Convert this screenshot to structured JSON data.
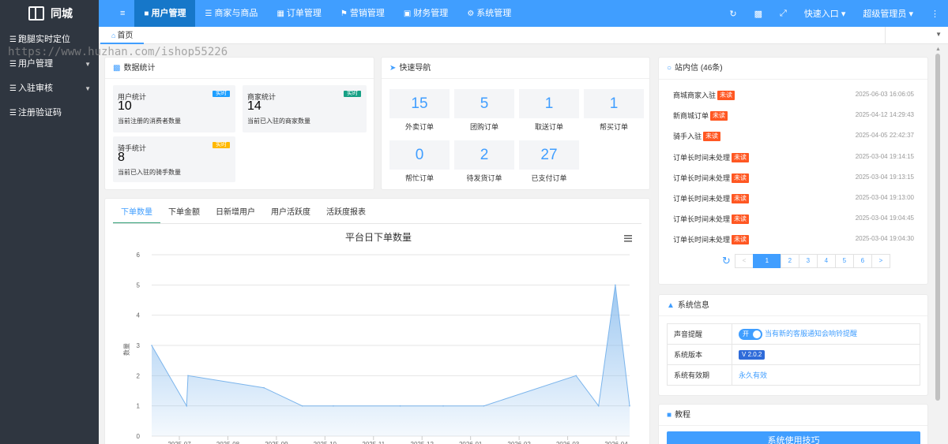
{
  "header": {
    "logo_text": "同城",
    "toggle_icon": "≡",
    "menu": [
      {
        "label": "用户管理",
        "icon": "users-icon"
      },
      {
        "label": "商家与商品",
        "icon": "list-icon"
      },
      {
        "label": "订单管理",
        "icon": "grid-icon"
      },
      {
        "label": "营销管理",
        "icon": "flag-icon"
      },
      {
        "label": "财务管理",
        "icon": "wallet-icon"
      },
      {
        "label": "系统管理",
        "icon": "gear-icon"
      }
    ],
    "quick_entry": "快速入口",
    "admin": "超级管理员"
  },
  "sidebar": {
    "items": [
      {
        "label": "跑腿实时定位",
        "has_arrow": false
      },
      {
        "label": "用户管理",
        "has_arrow": true
      },
      {
        "label": "入驻审核",
        "has_arrow": true
      },
      {
        "label": "注册验证码",
        "has_arrow": false
      }
    ]
  },
  "tabs": {
    "home": "首页"
  },
  "watermark": "https://www.huzhan.com/ishop55226",
  "stats": {
    "title": "数据统计",
    "items": [
      {
        "label": "用户统计",
        "badge": "实时",
        "badge_color": "#1e9fff",
        "value": "10",
        "sub": "当前注册的消费者数量"
      },
      {
        "label": "商家统计",
        "badge": "实时",
        "badge_color": "#16a085",
        "value": "14",
        "sub": "当前已入驻的商家数量"
      },
      {
        "label": "骑手统计",
        "badge": "实时",
        "badge_color": "#ffb800",
        "value": "8",
        "sub": "当前已入驻的骑手数量"
      }
    ]
  },
  "quicknav": {
    "title": "快速导航",
    "items": [
      {
        "value": "15",
        "label": "外卖订单"
      },
      {
        "value": "5",
        "label": "团购订单"
      },
      {
        "value": "1",
        "label": "取送订单"
      },
      {
        "value": "1",
        "label": "帮买订单"
      },
      {
        "value": "0",
        "label": "帮忙订单"
      },
      {
        "value": "2",
        "label": "待发货订单"
      },
      {
        "value": "27",
        "label": "已支付订单"
      }
    ]
  },
  "chart_tabs": [
    "下单数量",
    "下单金额",
    "日新增用户",
    "用户活跃度",
    "活跃度报表"
  ],
  "chart_data": {
    "type": "area",
    "title": "平台日下单数量",
    "ylabel": "数量",
    "ylim": [
      0,
      6
    ],
    "yticks": [
      "0",
      "1",
      "2",
      "3",
      "4",
      "5",
      "6"
    ],
    "xticks": [
      "2025-07",
      "2025-08",
      "2025-09",
      "2025-10",
      "2025-11",
      "2025-12",
      "2026-01",
      "2026-02",
      "2026-03",
      "2026-04"
    ],
    "series": [
      {
        "values": [
          3,
          1,
          2,
          1.6,
          1,
          1,
          1,
          1,
          1,
          2,
          1,
          5,
          1
        ]
      }
    ],
    "color": "#7cb5ec"
  },
  "messages": {
    "title": "站内信 (46条)",
    "unread_label": "未读",
    "items": [
      {
        "title": "商城商家入驻",
        "date": "2025-06-03 16:06:05"
      },
      {
        "title": "新商城订单",
        "date": "2025-04-12 14:29:43"
      },
      {
        "title": "骑手入驻",
        "date": "2025-04-05 22:42:37"
      },
      {
        "title": "订单长时间未处理",
        "date": "2025-03-04 19:14:15"
      },
      {
        "title": "订单长时间未处理",
        "date": "2025-03-04 19:13:15"
      },
      {
        "title": "订单长时间未处理",
        "date": "2025-03-04 19:13:00"
      },
      {
        "title": "订单长时间未处理",
        "date": "2025-03-04 19:04:45"
      },
      {
        "title": "订单长时间未处理",
        "date": "2025-03-04 19:04:30"
      }
    ],
    "pager": {
      "prev": "<",
      "next": ">",
      "pages": [
        "1",
        "2",
        "3",
        "4",
        "5",
        "6"
      ],
      "current": "1"
    }
  },
  "sysinfo": {
    "title": "系统信息",
    "rows": {
      "sound_label": "声音提醒",
      "switch_text": "开",
      "sound_desc": "当有新的客服通知会响铃提醒",
      "version_label": "系统版本",
      "version_value": "2.0.2",
      "validity_label": "系统有效期",
      "validity_value": "永久有效"
    }
  },
  "tutorial": {
    "title": "教程",
    "button": "系统使用技巧"
  }
}
